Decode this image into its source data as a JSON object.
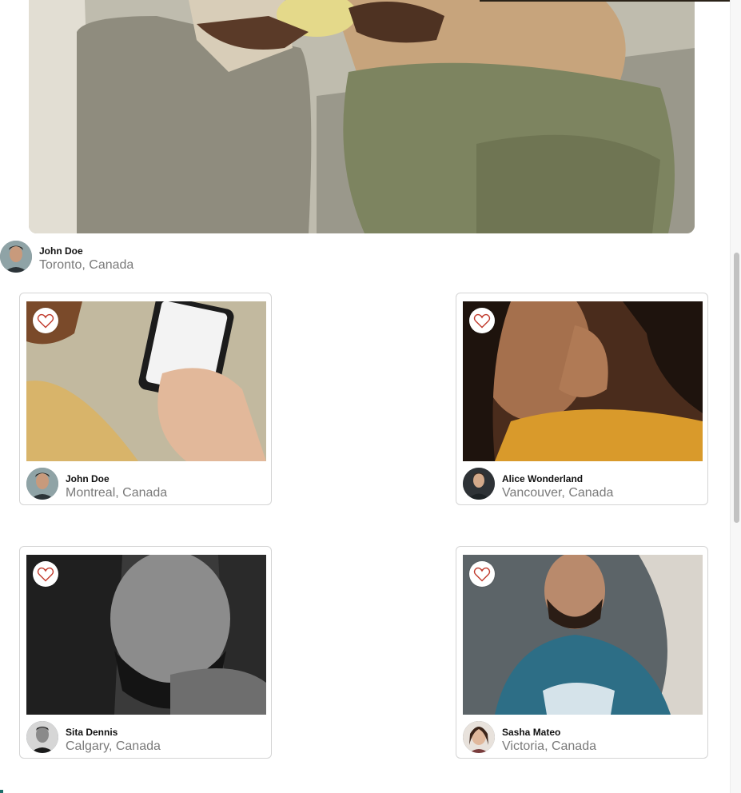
{
  "hero_post": {
    "author": {
      "name": "John Doe",
      "location": "Toronto, Canada"
    }
  },
  "cards": [
    {
      "author": {
        "name": "John Doe",
        "location": "Montreal, Canada"
      },
      "like_icon": "heart-outline-icon"
    },
    {
      "author": {
        "name": "Alice Wonderland",
        "location": "Vancouver, Canada"
      },
      "like_icon": "heart-outline-icon"
    },
    {
      "author": {
        "name": "Sita Dennis",
        "location": "Calgary, Canada"
      },
      "like_icon": "heart-outline-icon"
    },
    {
      "author": {
        "name": "Sasha Mateo",
        "location": "Victoria, Canada"
      },
      "like_icon": "heart-outline-icon"
    }
  ],
  "colors": {
    "heart": "#c0392b",
    "name_text": "#111111",
    "location_text": "#7a7a7a",
    "card_border": "#d4d4d4"
  }
}
